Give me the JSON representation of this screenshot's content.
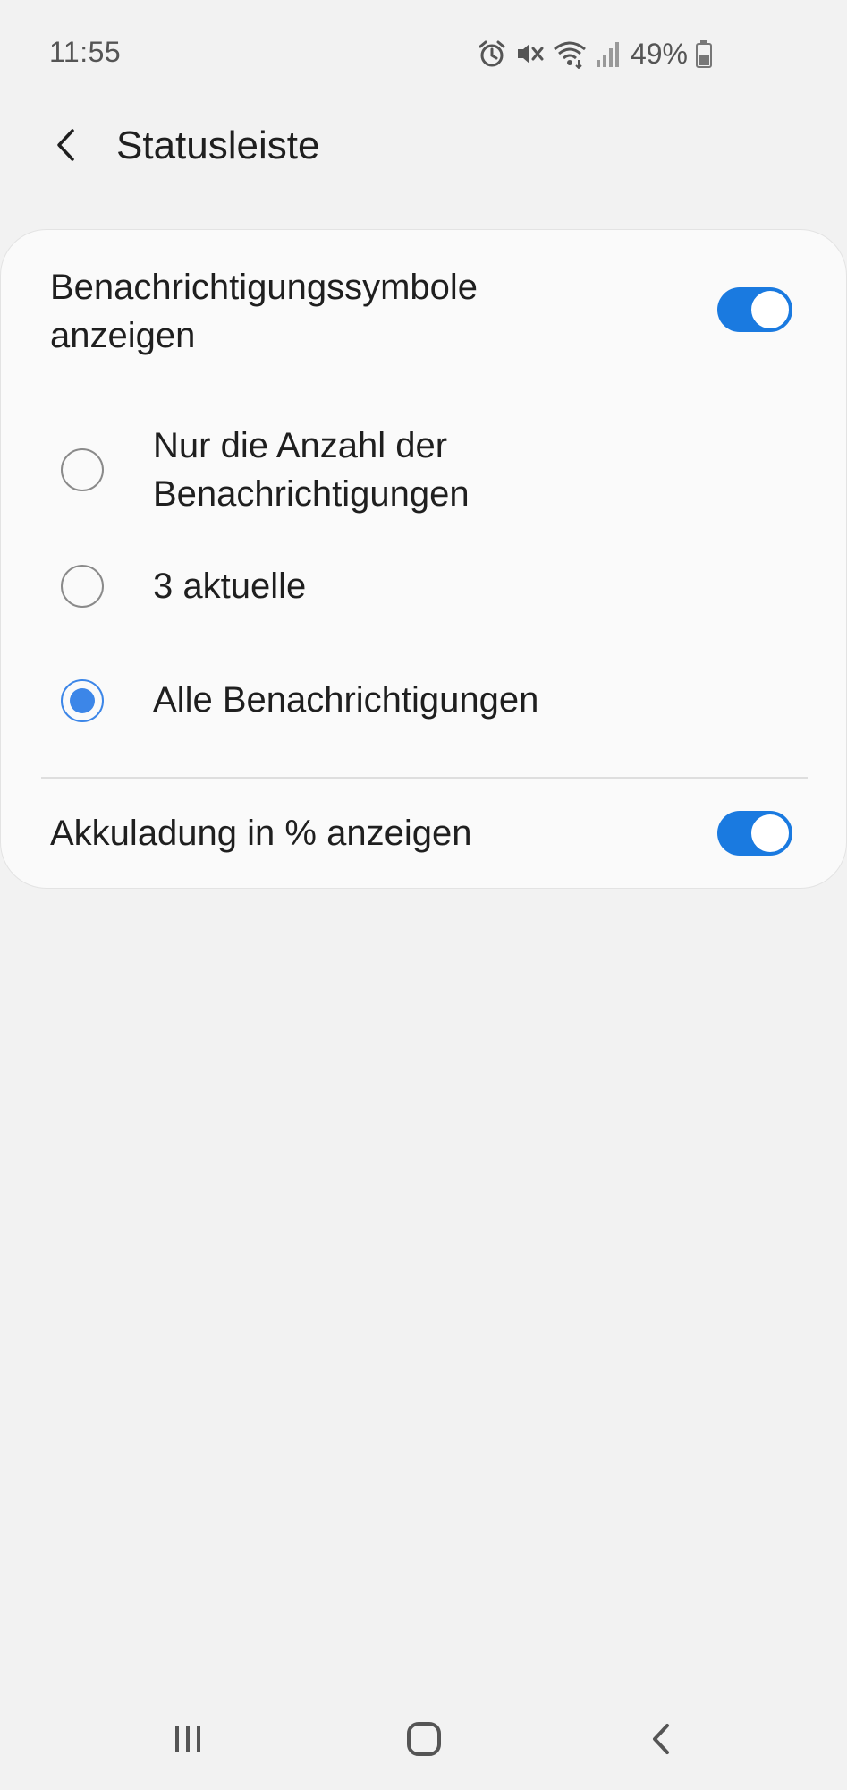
{
  "status_bar": {
    "time": "11:55",
    "icons": [
      "alarm-icon",
      "mute-icon",
      "wifi-icon",
      "signal-icon",
      "battery-icon"
    ],
    "battery_percent": "49%"
  },
  "header": {
    "back_icon": "chevron-left-icon",
    "title": "Statusleiste"
  },
  "settings": {
    "notification_icons": {
      "label_line1": "Benachrichtigungssymbole",
      "label_line2": "anzeigen",
      "enabled": true
    },
    "options": [
      {
        "label_line1": "Nur die Anzahl der",
        "label_line2": "Benachrichtigungen",
        "selected": false
      },
      {
        "label": "3 aktuelle",
        "selected": false
      },
      {
        "label": "Alle Benachrichtigungen",
        "selected": true
      }
    ],
    "battery_percent_toggle": {
      "label": "Akkuladung in % anzeigen",
      "enabled": true
    }
  },
  "nav_bar": {
    "buttons": [
      "recent-apps-icon",
      "home-icon",
      "back-icon"
    ]
  },
  "colors": {
    "accent": "#1a7ae0",
    "radio_checked": "#3c86e8",
    "background": "#f2f2f2",
    "card": "#fafafa"
  }
}
